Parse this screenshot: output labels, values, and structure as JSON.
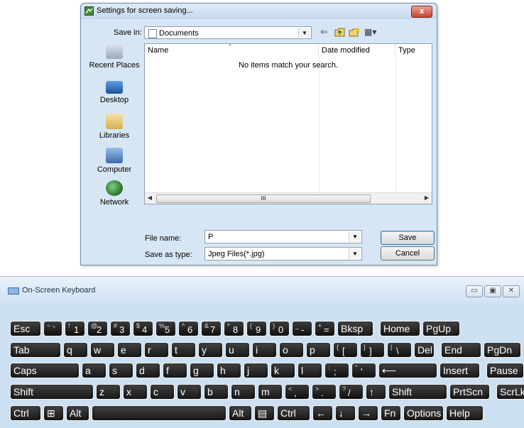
{
  "dialog": {
    "title": "Settings for screen saving...",
    "close_label": "x",
    "save_in_label": "Save in:",
    "save_in_value": "Documents",
    "toolbar_icons": [
      "back-arrow-icon",
      "up-folder-icon",
      "new-folder-icon",
      "view-menu-icon"
    ],
    "places": [
      {
        "label": "Recent Places",
        "icon": "recent-places-icon",
        "color": "#9aa8b8"
      },
      {
        "label": "Desktop",
        "icon": "desktop-icon",
        "color": "#2f6db8"
      },
      {
        "label": "Libraries",
        "icon": "libraries-icon",
        "color": "#e5c26a"
      },
      {
        "label": "Computer",
        "icon": "computer-icon",
        "color": "#5b88c4"
      },
      {
        "label": "Network",
        "icon": "network-icon",
        "color": "#3b8a3e"
      }
    ],
    "columns": [
      "Name",
      "Date modified",
      "Type"
    ],
    "empty_message": "No items match your search.",
    "scroll_grip": "III",
    "file_name_label": "File name:",
    "file_name_value": "P",
    "save_type_label": "Save as type:",
    "save_type_value": "Jpeg Files(*.jpg)",
    "save_button": "Save",
    "cancel_button": "Cancel"
  },
  "osk": {
    "title": "On-Screen Keyboard",
    "window_buttons": [
      "minimize-icon",
      "maximize-icon",
      "close-icon"
    ],
    "rows": [
      [
        {
          "k": "Esc"
        },
        {
          "k": "`",
          "s": "~"
        },
        {
          "k": "1",
          "s": "!"
        },
        {
          "k": "2",
          "s": "@"
        },
        {
          "k": "3",
          "s": "#"
        },
        {
          "k": "4",
          "s": "$"
        },
        {
          "k": "5",
          "s": "%"
        },
        {
          "k": "6",
          "s": "^"
        },
        {
          "k": "7",
          "s": "&"
        },
        {
          "k": "8",
          "s": "*"
        },
        {
          "k": "9",
          "s": "("
        },
        {
          "k": "0",
          "s": ")"
        },
        {
          "k": "-",
          "s": "_"
        },
        {
          "k": "=",
          "s": "+"
        },
        {
          "k": "Bksp"
        },
        {
          "k": "Home"
        },
        {
          "k": "PgUp"
        }
      ],
      [
        {
          "k": "Tab"
        },
        {
          "k": "q"
        },
        {
          "k": "w"
        },
        {
          "k": "e"
        },
        {
          "k": "r"
        },
        {
          "k": "t"
        },
        {
          "k": "y"
        },
        {
          "k": "u"
        },
        {
          "k": "i"
        },
        {
          "k": "o"
        },
        {
          "k": "p"
        },
        {
          "k": "[",
          "s": "{"
        },
        {
          "k": "]",
          "s": "}"
        },
        {
          "k": "\\",
          "s": "|"
        },
        {
          "k": "Del"
        },
        {
          "k": "End"
        },
        {
          "k": "PgDn"
        }
      ],
      [
        {
          "k": "Caps"
        },
        {
          "k": "a"
        },
        {
          "k": "s"
        },
        {
          "k": "d"
        },
        {
          "k": "f"
        },
        {
          "k": "g"
        },
        {
          "k": "h"
        },
        {
          "k": "j"
        },
        {
          "k": "k"
        },
        {
          "k": "l"
        },
        {
          "k": ";",
          "s": ":"
        },
        {
          "k": "'",
          "s": "\""
        },
        {
          "k": "⟵"
        },
        {
          "k": "Insert"
        },
        {
          "k": "Pause"
        }
      ],
      [
        {
          "k": "Shift"
        },
        {
          "k": "z"
        },
        {
          "k": "x"
        },
        {
          "k": "c"
        },
        {
          "k": "v"
        },
        {
          "k": "b"
        },
        {
          "k": "n"
        },
        {
          "k": "m"
        },
        {
          "k": ",",
          "s": "<"
        },
        {
          "k": ".",
          "s": ">"
        },
        {
          "k": "/",
          "s": "?"
        },
        {
          "k": "↑"
        },
        {
          "k": "Shift"
        },
        {
          "k": "PrtScn"
        },
        {
          "k": "ScrLk"
        }
      ],
      [
        {
          "k": "Ctrl"
        },
        {
          "k": "⊞"
        },
        {
          "k": "Alt"
        },
        {
          "k": ""
        },
        {
          "k": "Alt"
        },
        {
          "k": "▤"
        },
        {
          "k": "Ctrl"
        },
        {
          "k": "←"
        },
        {
          "k": "↓"
        },
        {
          "k": "→"
        },
        {
          "k": "Fn"
        },
        {
          "k": "Options"
        },
        {
          "k": "Help"
        }
      ]
    ]
  }
}
